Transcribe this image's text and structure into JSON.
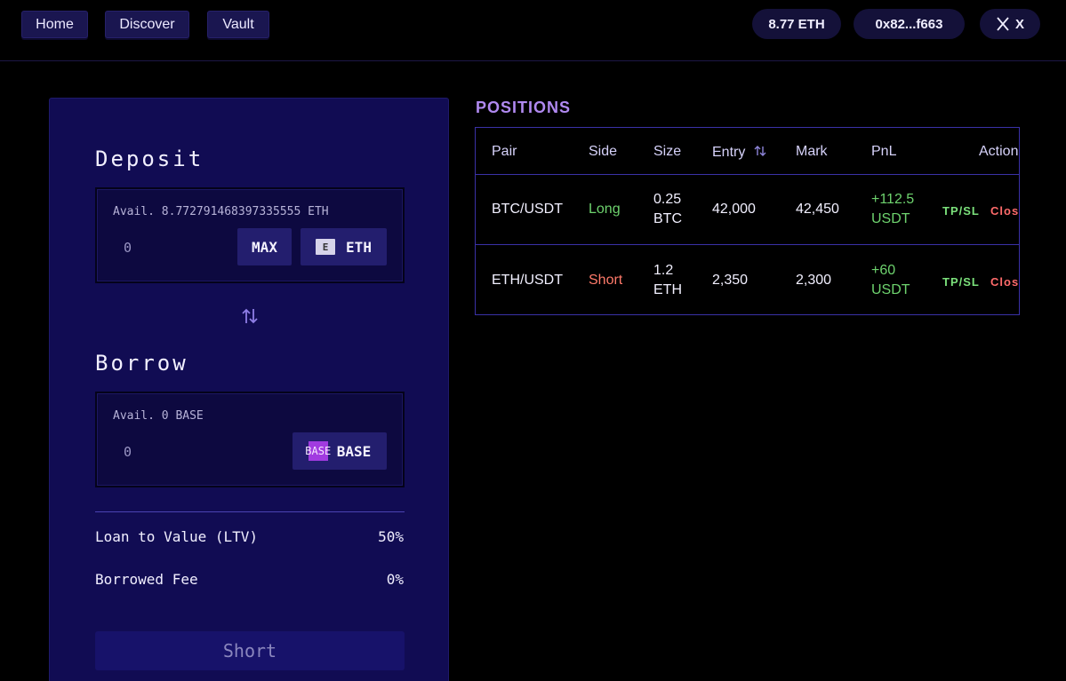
{
  "nav": {
    "home": "Home",
    "discover": "Discover",
    "vault": "Vault"
  },
  "wallet": {
    "balance": "8.77 ETH",
    "address": "0x82...f663",
    "social_label": "X"
  },
  "deposit": {
    "title": "Deposit",
    "avail": "Avail. 8.772791468397335555 ETH",
    "amount": "0",
    "max_label": "MAX",
    "token_img_alt": "E",
    "token_label": "ETH"
  },
  "borrow": {
    "title": "Borrow",
    "avail": "Avail. 0 BASE",
    "amount": "0",
    "token_icon_text": "BASE",
    "token_label": "BASE"
  },
  "stats": {
    "ltv_label": "Loan to Value (LTV)",
    "ltv_value": "50%",
    "fee_label": "Borrowed Fee",
    "fee_value": "0%"
  },
  "action_label": "Short",
  "positions": {
    "title": "POSITIONS",
    "headers": {
      "pair": "Pair",
      "side": "Side",
      "size": "Size",
      "entry": "Entry",
      "mark": "Mark",
      "pnl": "PnL",
      "action": "Action"
    },
    "rows": [
      {
        "pair": "BTC/USDT",
        "side": "Long",
        "size_amount": "0.25",
        "size_unit": "BTC",
        "entry": "42,000",
        "mark": "42,450",
        "pnl_amount": "+112.5",
        "pnl_unit": "USDT",
        "tp_label": "TP/SL",
        "close_label": "Clos"
      },
      {
        "pair": "ETH/USDT",
        "side": "Short",
        "size_amount": "1.2",
        "size_unit": "ETH",
        "entry": "2,350",
        "mark": "2,300",
        "pnl_amount": "+60",
        "pnl_unit": "USDT",
        "tp_label": "TP/SL",
        "close_label": "Clos"
      }
    ]
  },
  "colors": {
    "background": "#000000",
    "card": "#110c53",
    "accent_purple": "#b089f0",
    "long_green": "#6ed36e",
    "short_red": "#ff7a6a"
  },
  "icons": {
    "swap": "swap-vertical-icon",
    "sort": "sort-icon",
    "x_logo": "x-logo-icon",
    "eth_token": "eth-token-icon",
    "base_token": "base-token-icon"
  }
}
